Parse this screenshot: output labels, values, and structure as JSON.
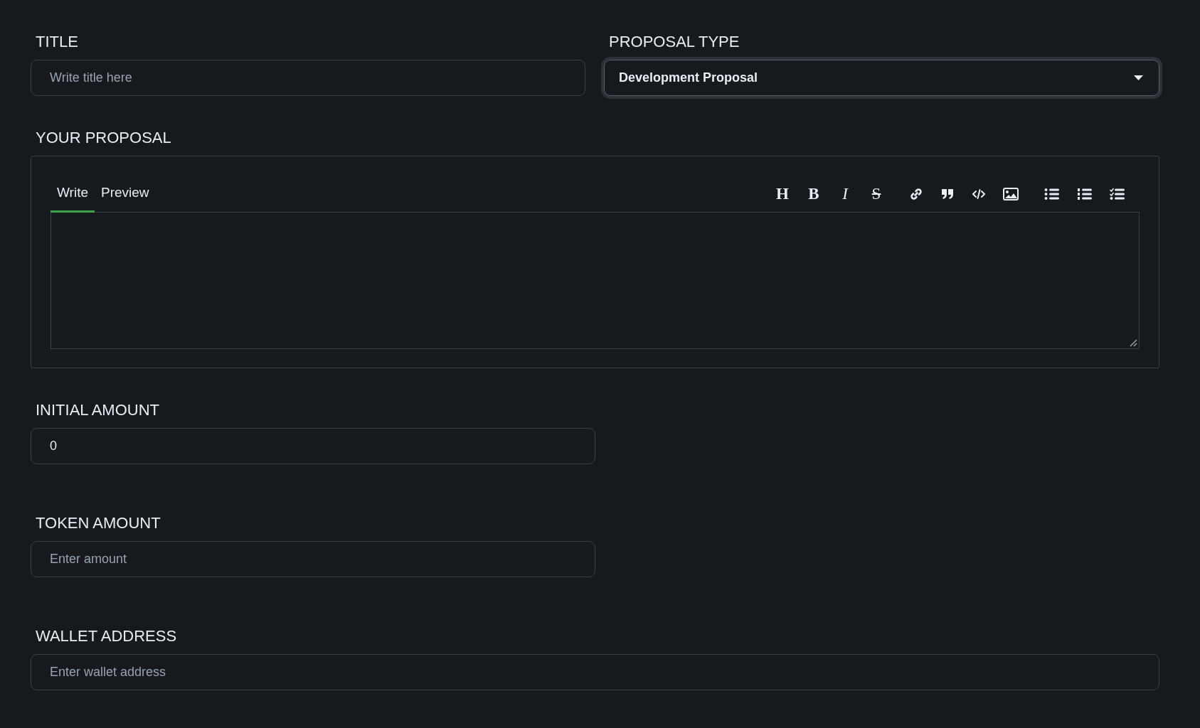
{
  "title_field": {
    "label": "TITLE",
    "placeholder": "Write title here"
  },
  "proposal_type": {
    "label": "PROPOSAL TYPE",
    "value": "Development Proposal",
    "focused": true
  },
  "proposal": {
    "label": "YOUR PROPOSAL",
    "tabs": [
      {
        "label": "Write",
        "selected": true
      },
      {
        "label": "Preview",
        "selected": false
      }
    ],
    "toolbar": [
      [
        {
          "kind": "heading",
          "glyph": "H"
        },
        {
          "kind": "bold",
          "glyph": "B"
        },
        {
          "kind": "italic",
          "glyph": "I"
        },
        {
          "kind": "strike",
          "glyph": "S"
        }
      ],
      [
        {
          "kind": "link"
        },
        {
          "kind": "quote"
        },
        {
          "kind": "code"
        },
        {
          "kind": "image"
        }
      ],
      [
        {
          "kind": "bullets"
        },
        {
          "kind": "numbers"
        },
        {
          "kind": "tasks"
        }
      ]
    ]
  },
  "initial_amount": {
    "label": "INITIAL AMOUNT",
    "value": "0"
  },
  "token_amount": {
    "label": "TOKEN AMOUNT",
    "placeholder": "Enter amount"
  },
  "wallet_address": {
    "label": "WALLET ADDRESS",
    "placeholder": "Enter wallet address"
  }
}
